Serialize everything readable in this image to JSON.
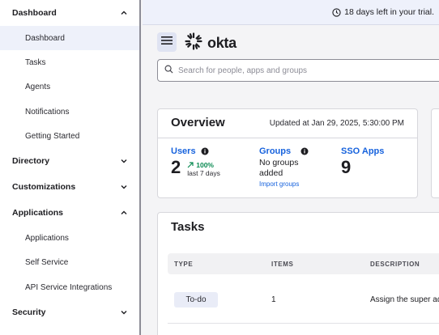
{
  "banner": {
    "trial_text": "18 days left in your trial."
  },
  "header": {
    "logo_text": "okta"
  },
  "search": {
    "placeholder": "Search for people, apps and groups"
  },
  "sidebar": {
    "dashboard": {
      "label": "Dashboard",
      "items": [
        "Dashboard",
        "Tasks",
        "Agents",
        "Notifications",
        "Getting Started"
      ]
    },
    "directory": {
      "label": "Directory"
    },
    "customizations": {
      "label": "Customizations"
    },
    "applications": {
      "label": "Applications",
      "items": [
        "Applications",
        "Self Service",
        "API Service Integrations"
      ]
    },
    "security": {
      "label": "Security"
    }
  },
  "overview": {
    "title": "Overview",
    "updated": "Updated at Jan 29, 2025, 5:30:00 PM",
    "users": {
      "label": "Users",
      "count": "2",
      "trend": "100%",
      "trend_sub": "last 7 days"
    },
    "groups": {
      "label": "Groups",
      "line1": "No groups",
      "line2": "added",
      "link": "Import groups"
    },
    "sso": {
      "label": "SSO Apps",
      "count": "9"
    }
  },
  "tasks": {
    "title": "Tasks",
    "columns": [
      "TYPE",
      "ITEMS",
      "DESCRIPTION"
    ],
    "rows": [
      {
        "type": "To-do",
        "items": "1",
        "description": "Assign the super adr"
      }
    ]
  },
  "colors": {
    "accent": "#1662dd",
    "trend_green": "#0a8a52",
    "sidebar_active": "#eef1fa"
  }
}
